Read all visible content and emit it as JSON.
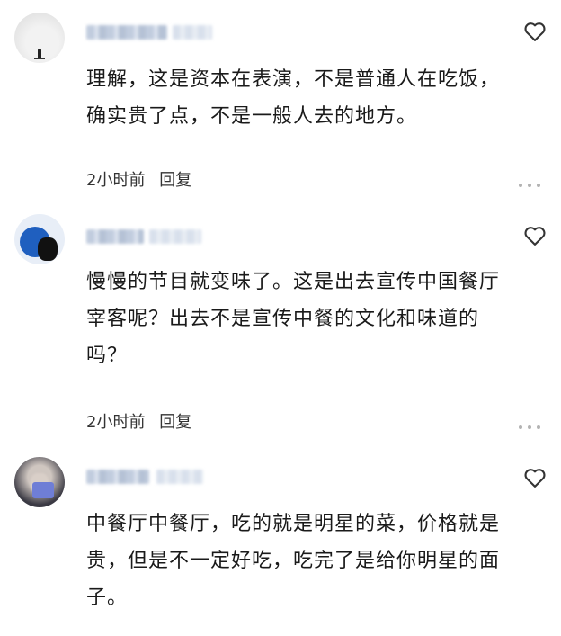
{
  "comments": [
    {
      "text_lines": [
        "理解，这是资本在表演，不是普通人在吃饭，",
        "确实贵了点，不是一般人去的地方。"
      ],
      "time": "2小时前",
      "reply_label": "回复"
    },
    {
      "text_lines": [
        "慢慢的节目就变味了。这是出去宣传中国餐厅",
        "宰客呢？出去不是宣传中餐的文化和味道的",
        "吗？"
      ],
      "time": "2小时前",
      "reply_label": "回复"
    },
    {
      "text_lines": [
        "中餐厅中餐厅，吃的就是明星的菜，价格就是",
        "贵，但是不一定好吃，吃完了是给你明星的面",
        "子。"
      ]
    }
  ],
  "icons": {
    "like": "heart-outline-icon",
    "more": "more-dots-icon"
  }
}
